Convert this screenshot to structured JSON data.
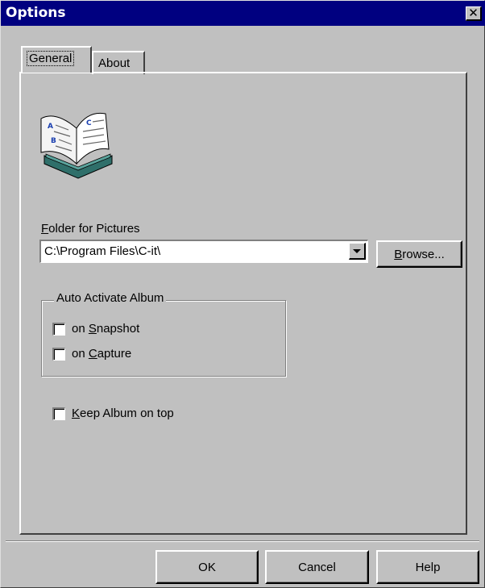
{
  "window": {
    "title": "Options",
    "close_glyph": "✕"
  },
  "tabs": [
    {
      "label": "General",
      "active": true
    },
    {
      "label": "About",
      "active": false
    }
  ],
  "general": {
    "icon": "open-book-icon",
    "folder": {
      "label_accel": "F",
      "label_rest": "older for Pictures",
      "value": "C:\\Program Files\\C-it\\",
      "browse_accel": "B",
      "browse_rest": "rowse..."
    },
    "auto_activate": {
      "legend": "Auto Activate Album",
      "snapshot": {
        "prefix": "on ",
        "accel": "S",
        "rest": "napshot",
        "checked": false
      },
      "capture": {
        "prefix": "on ",
        "accel": "C",
        "rest": "apture",
        "checked": false
      }
    },
    "keep_on_top": {
      "accel": "K",
      "rest": "eep Album on top",
      "checked": false
    }
  },
  "buttons": {
    "ok": "OK",
    "cancel": "Cancel",
    "help": "Help"
  }
}
